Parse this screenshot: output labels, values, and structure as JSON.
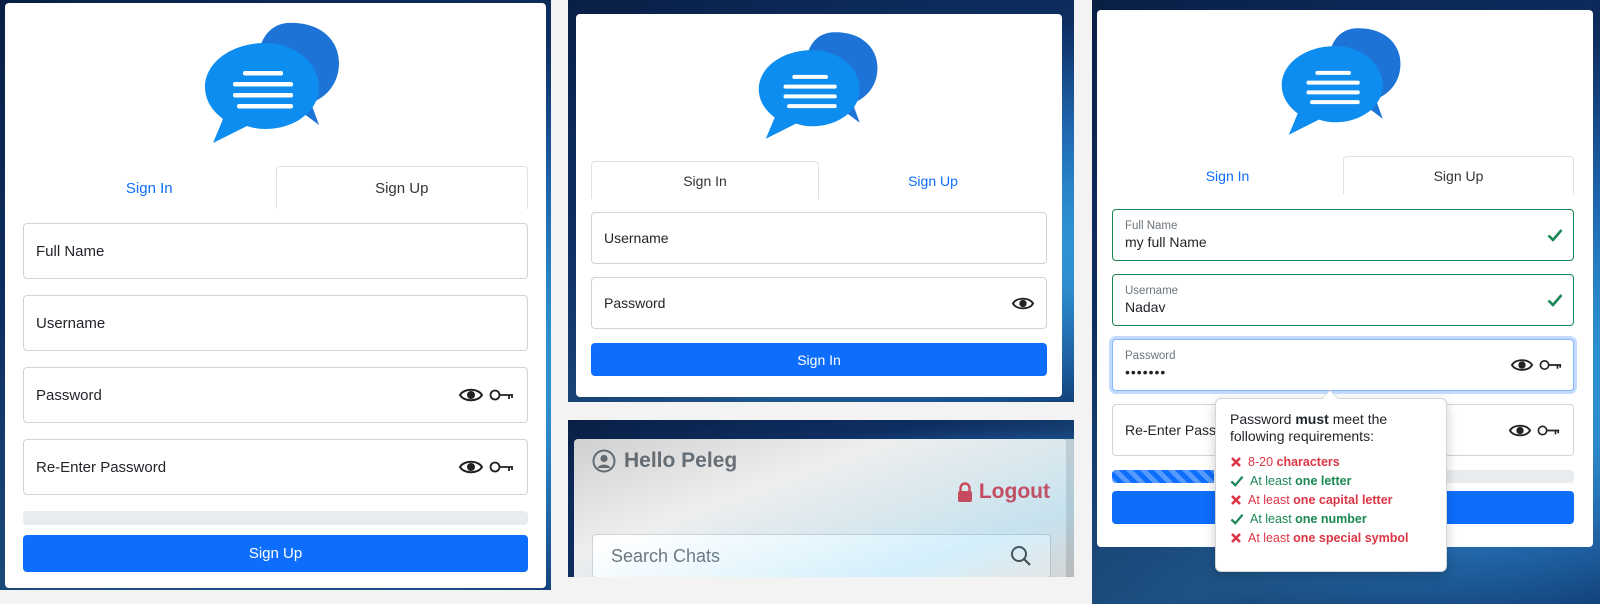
{
  "colors": {
    "primary": "#0d6efd",
    "success": "#198754",
    "danger": "#dc3545",
    "muted": "#6c757d"
  },
  "signup_panel": {
    "tabs": [
      {
        "label": "Sign In",
        "active": false
      },
      {
        "label": "Sign Up",
        "active": true
      }
    ],
    "fields": {
      "full_name": "Full Name",
      "username": "Username",
      "password": "Password",
      "reenter_password": "Re-Enter Password"
    },
    "submit_label": "Sign Up"
  },
  "signin_panel": {
    "tabs": [
      {
        "label": "Sign In",
        "active": true
      },
      {
        "label": "Sign Up",
        "active": false
      }
    ],
    "fields": {
      "username": "Username",
      "password": "Password"
    },
    "submit_label": "Sign In"
  },
  "chat_panel": {
    "greeting": "Hello Peleg",
    "logout_label": "Logout",
    "search_placeholder": "Search Chats"
  },
  "validation_panel": {
    "tabs": [
      {
        "label": "Sign In",
        "active": false
      },
      {
        "label": "Sign Up",
        "active": true
      }
    ],
    "full_name": {
      "label": "Full Name",
      "value": "my full Name"
    },
    "username": {
      "label": "Username",
      "value": "Nadav"
    },
    "password": {
      "label": "Password",
      "value": "•••••••"
    },
    "reenter_label": "Re-Enter Pass",
    "password_strength": 0.22,
    "tooltip": {
      "prefix": "Password ",
      "must": "must",
      "suffix": " meet the following requirements:",
      "requirements": [
        {
          "prefix": "8-20 ",
          "bold": "characters",
          "met": false
        },
        {
          "prefix": "At least ",
          "bold": "one letter",
          "met": true
        },
        {
          "prefix": "At least ",
          "bold": "one capital letter",
          "met": false
        },
        {
          "prefix": "At least ",
          "bold": "one number",
          "met": true
        },
        {
          "prefix": "At least ",
          "bold": "one special symbol",
          "met": false
        }
      ]
    }
  }
}
